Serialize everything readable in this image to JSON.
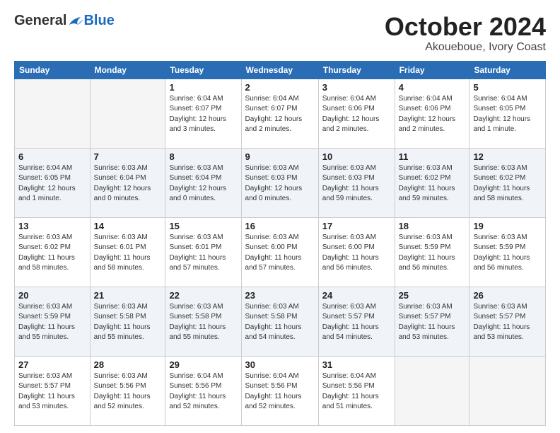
{
  "logo": {
    "general": "General",
    "blue": "Blue"
  },
  "header": {
    "month": "October 2024",
    "location": "Akoueboue, Ivory Coast"
  },
  "weekdays": [
    "Sunday",
    "Monday",
    "Tuesday",
    "Wednesday",
    "Thursday",
    "Friday",
    "Saturday"
  ],
  "weeks": [
    [
      {
        "day": "",
        "empty": true
      },
      {
        "day": "",
        "empty": true
      },
      {
        "day": "1",
        "sunrise": "Sunrise: 6:04 AM",
        "sunset": "Sunset: 6:07 PM",
        "daylight": "Daylight: 12 hours and 3 minutes."
      },
      {
        "day": "2",
        "sunrise": "Sunrise: 6:04 AM",
        "sunset": "Sunset: 6:07 PM",
        "daylight": "Daylight: 12 hours and 2 minutes."
      },
      {
        "day": "3",
        "sunrise": "Sunrise: 6:04 AM",
        "sunset": "Sunset: 6:06 PM",
        "daylight": "Daylight: 12 hours and 2 minutes."
      },
      {
        "day": "4",
        "sunrise": "Sunrise: 6:04 AM",
        "sunset": "Sunset: 6:06 PM",
        "daylight": "Daylight: 12 hours and 2 minutes."
      },
      {
        "day": "5",
        "sunrise": "Sunrise: 6:04 AM",
        "sunset": "Sunset: 6:05 PM",
        "daylight": "Daylight: 12 hours and 1 minute."
      }
    ],
    [
      {
        "day": "6",
        "sunrise": "Sunrise: 6:04 AM",
        "sunset": "Sunset: 6:05 PM",
        "daylight": "Daylight: 12 hours and 1 minute."
      },
      {
        "day": "7",
        "sunrise": "Sunrise: 6:03 AM",
        "sunset": "Sunset: 6:04 PM",
        "daylight": "Daylight: 12 hours and 0 minutes."
      },
      {
        "day": "8",
        "sunrise": "Sunrise: 6:03 AM",
        "sunset": "Sunset: 6:04 PM",
        "daylight": "Daylight: 12 hours and 0 minutes."
      },
      {
        "day": "9",
        "sunrise": "Sunrise: 6:03 AM",
        "sunset": "Sunset: 6:03 PM",
        "daylight": "Daylight: 12 hours and 0 minutes."
      },
      {
        "day": "10",
        "sunrise": "Sunrise: 6:03 AM",
        "sunset": "Sunset: 6:03 PM",
        "daylight": "Daylight: 11 hours and 59 minutes."
      },
      {
        "day": "11",
        "sunrise": "Sunrise: 6:03 AM",
        "sunset": "Sunset: 6:02 PM",
        "daylight": "Daylight: 11 hours and 59 minutes."
      },
      {
        "day": "12",
        "sunrise": "Sunrise: 6:03 AM",
        "sunset": "Sunset: 6:02 PM",
        "daylight": "Daylight: 11 hours and 58 minutes."
      }
    ],
    [
      {
        "day": "13",
        "sunrise": "Sunrise: 6:03 AM",
        "sunset": "Sunset: 6:02 PM",
        "daylight": "Daylight: 11 hours and 58 minutes."
      },
      {
        "day": "14",
        "sunrise": "Sunrise: 6:03 AM",
        "sunset": "Sunset: 6:01 PM",
        "daylight": "Daylight: 11 hours and 58 minutes."
      },
      {
        "day": "15",
        "sunrise": "Sunrise: 6:03 AM",
        "sunset": "Sunset: 6:01 PM",
        "daylight": "Daylight: 11 hours and 57 minutes."
      },
      {
        "day": "16",
        "sunrise": "Sunrise: 6:03 AM",
        "sunset": "Sunset: 6:00 PM",
        "daylight": "Daylight: 11 hours and 57 minutes."
      },
      {
        "day": "17",
        "sunrise": "Sunrise: 6:03 AM",
        "sunset": "Sunset: 6:00 PM",
        "daylight": "Daylight: 11 hours and 56 minutes."
      },
      {
        "day": "18",
        "sunrise": "Sunrise: 6:03 AM",
        "sunset": "Sunset: 5:59 PM",
        "daylight": "Daylight: 11 hours and 56 minutes."
      },
      {
        "day": "19",
        "sunrise": "Sunrise: 6:03 AM",
        "sunset": "Sunset: 5:59 PM",
        "daylight": "Daylight: 11 hours and 56 minutes."
      }
    ],
    [
      {
        "day": "20",
        "sunrise": "Sunrise: 6:03 AM",
        "sunset": "Sunset: 5:59 PM",
        "daylight": "Daylight: 11 hours and 55 minutes."
      },
      {
        "day": "21",
        "sunrise": "Sunrise: 6:03 AM",
        "sunset": "Sunset: 5:58 PM",
        "daylight": "Daylight: 11 hours and 55 minutes."
      },
      {
        "day": "22",
        "sunrise": "Sunrise: 6:03 AM",
        "sunset": "Sunset: 5:58 PM",
        "daylight": "Daylight: 11 hours and 55 minutes."
      },
      {
        "day": "23",
        "sunrise": "Sunrise: 6:03 AM",
        "sunset": "Sunset: 5:58 PM",
        "daylight": "Daylight: 11 hours and 54 minutes."
      },
      {
        "day": "24",
        "sunrise": "Sunrise: 6:03 AM",
        "sunset": "Sunset: 5:57 PM",
        "daylight": "Daylight: 11 hours and 54 minutes."
      },
      {
        "day": "25",
        "sunrise": "Sunrise: 6:03 AM",
        "sunset": "Sunset: 5:57 PM",
        "daylight": "Daylight: 11 hours and 53 minutes."
      },
      {
        "day": "26",
        "sunrise": "Sunrise: 6:03 AM",
        "sunset": "Sunset: 5:57 PM",
        "daylight": "Daylight: 11 hours and 53 minutes."
      }
    ],
    [
      {
        "day": "27",
        "sunrise": "Sunrise: 6:03 AM",
        "sunset": "Sunset: 5:57 PM",
        "daylight": "Daylight: 11 hours and 53 minutes."
      },
      {
        "day": "28",
        "sunrise": "Sunrise: 6:03 AM",
        "sunset": "Sunset: 5:56 PM",
        "daylight": "Daylight: 11 hours and 52 minutes."
      },
      {
        "day": "29",
        "sunrise": "Sunrise: 6:04 AM",
        "sunset": "Sunset: 5:56 PM",
        "daylight": "Daylight: 11 hours and 52 minutes."
      },
      {
        "day": "30",
        "sunrise": "Sunrise: 6:04 AM",
        "sunset": "Sunset: 5:56 PM",
        "daylight": "Daylight: 11 hours and 52 minutes."
      },
      {
        "day": "31",
        "sunrise": "Sunrise: 6:04 AM",
        "sunset": "Sunset: 5:56 PM",
        "daylight": "Daylight: 11 hours and 51 minutes."
      },
      {
        "day": "",
        "empty": true
      },
      {
        "day": "",
        "empty": true
      }
    ]
  ]
}
